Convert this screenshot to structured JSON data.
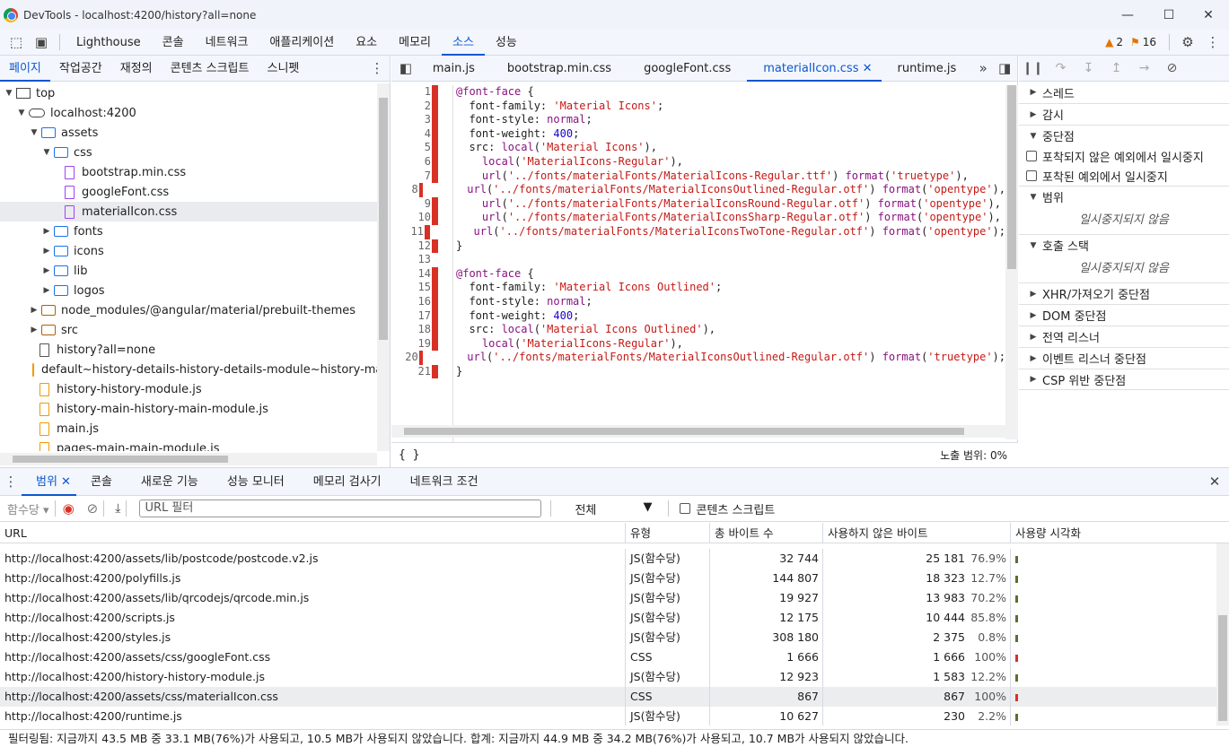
{
  "window": {
    "title": "DevTools - localhost:4200/history?all=none"
  },
  "main_tabs": [
    {
      "label": "Lighthouse"
    },
    {
      "label": "콘솔"
    },
    {
      "label": "네트워크"
    },
    {
      "label": "애플리케이션"
    },
    {
      "label": "요소"
    },
    {
      "label": "메모리"
    },
    {
      "label": "소스"
    },
    {
      "label": "성능"
    }
  ],
  "active_main_tab": "소스",
  "badges": {
    "warnings": "2",
    "issues": "16"
  },
  "left": {
    "tabs": [
      "페이지",
      "작업공간",
      "재정의",
      "콘텐츠 스크립트",
      "스니펫"
    ],
    "tree": [
      {
        "label": "top",
        "indent": 0,
        "kind": "frame",
        "open": true
      },
      {
        "label": "localhost:4200",
        "indent": 1,
        "kind": "cloud",
        "open": true
      },
      {
        "label": "assets",
        "indent": 2,
        "kind": "folder",
        "open": true
      },
      {
        "label": "css",
        "indent": 3,
        "kind": "folder",
        "open": true
      },
      {
        "label": "bootstrap.min.css",
        "indent": 4,
        "kind": "css"
      },
      {
        "label": "googleFont.css",
        "indent": 4,
        "kind": "css"
      },
      {
        "label": "materialIcon.css",
        "indent": 4,
        "kind": "css",
        "selected": true
      },
      {
        "label": "fonts",
        "indent": 3,
        "kind": "folder",
        "open": false
      },
      {
        "label": "icons",
        "indent": 3,
        "kind": "folder",
        "open": false
      },
      {
        "label": "lib",
        "indent": 3,
        "kind": "folder",
        "open": false
      },
      {
        "label": "logos",
        "indent": 3,
        "kind": "folder",
        "open": false
      },
      {
        "label": "node_modules/@angular/material/prebuilt-themes",
        "indent": 2,
        "kind": "folder-brown",
        "open": false
      },
      {
        "label": "src",
        "indent": 2,
        "kind": "folder-brown",
        "open": false
      },
      {
        "label": "history?all=none",
        "indent": 2,
        "kind": "doc"
      },
      {
        "label": "default~history-details-history-details-module~history-main-history-main-module.js",
        "indent": 2,
        "kind": "js"
      },
      {
        "label": "history-history-module.js",
        "indent": 2,
        "kind": "js"
      },
      {
        "label": "history-main-history-main-module.js",
        "indent": 2,
        "kind": "js"
      },
      {
        "label": "main.js",
        "indent": 2,
        "kind": "js"
      },
      {
        "label": "pages-main-main-module.js",
        "indent": 2,
        "kind": "js"
      }
    ]
  },
  "editor": {
    "tabs": [
      "main.js",
      "bootstrap.min.css",
      "googleFont.css",
      "materialIcon.css",
      "runtime.js"
    ],
    "active_tab": "materialIcon.css",
    "status_coverage": "노출 범위: 0%",
    "lines": [
      {
        "n": "1",
        "text": "@font-face {",
        "cov": true
      },
      {
        "n": "2",
        "text": "  font-family: 'Material Icons';",
        "cov": true
      },
      {
        "n": "3",
        "text": "  font-style: normal;",
        "cov": true
      },
      {
        "n": "4",
        "text": "  font-weight: 400;",
        "cov": true
      },
      {
        "n": "5",
        "text": "  src: local('Material Icons'),",
        "cov": true
      },
      {
        "n": "6",
        "text": "    local('MaterialIcons-Regular'),",
        "cov": true
      },
      {
        "n": "7",
        "text": "    url('../fonts/materialFonts/MaterialIcons-Regular.ttf') format('truetype'),",
        "cov": true
      },
      {
        "n": "8",
        "text": "    url('../fonts/materialFonts/MaterialIconsOutlined-Regular.otf') format('opentype'),",
        "cov": true
      },
      {
        "n": "9",
        "text": "    url('../fonts/materialFonts/MaterialIconsRound-Regular.otf') format('opentype'),",
        "cov": true
      },
      {
        "n": "10",
        "text": "    url('../fonts/materialFonts/MaterialIconsSharp-Regular.otf') format('opentype'),",
        "cov": true
      },
      {
        "n": "11",
        "text": "    url('../fonts/materialFonts/MaterialIconsTwoTone-Regular.otf') format('opentype');",
        "cov": true
      },
      {
        "n": "12",
        "text": "}",
        "cov": true
      },
      {
        "n": "13",
        "text": "",
        "cov": false
      },
      {
        "n": "14",
        "text": "@font-face {",
        "cov": true
      },
      {
        "n": "15",
        "text": "  font-family: 'Material Icons Outlined';",
        "cov": true
      },
      {
        "n": "16",
        "text": "  font-style: normal;",
        "cov": true
      },
      {
        "n": "17",
        "text": "  font-weight: 400;",
        "cov": true
      },
      {
        "n": "18",
        "text": "  src: local('Material Icons Outlined'),",
        "cov": true
      },
      {
        "n": "19",
        "text": "    local('MaterialIcons-Regular'),",
        "cov": true
      },
      {
        "n": "20",
        "text": "    url('../fonts/materialFonts/MaterialIconsOutlined-Regular.otf') format('truetype');",
        "cov": true
      },
      {
        "n": "21",
        "text": "}",
        "cov": true
      }
    ]
  },
  "debugger": {
    "threads": "스레드",
    "watch": "감시",
    "breakpoints": "중단점",
    "pause_uncaught": "포착되지 않은 예외에서 일시중지",
    "pause_caught": "포착된 예외에서 일시중지",
    "scope": "범위",
    "not_paused_1": "일시중지되지 않음",
    "call_stack": "호출 스택",
    "not_paused_2": "일시중지되지 않음",
    "xhr": "XHR/가져오기 중단점",
    "dom": "DOM 중단점",
    "global": "전역 리스너",
    "event": "이벤트 리스너 중단점",
    "csp": "CSP 위반 중단점"
  },
  "drawer": {
    "tabs": [
      "범위",
      "콘솔",
      "새로운 기능",
      "성능 모니터",
      "메모리 검사기",
      "네트워크 조건"
    ],
    "granularity": "함수당",
    "url_filter_placeholder": "URL 필터",
    "type_filter": "전체",
    "content_scripts": "콘텐츠 스크립트",
    "columns": [
      "URL",
      "유형",
      "총 바이트 수",
      "사용하지 않은 바이트",
      "사용량 시각화"
    ],
    "rows": [
      {
        "url": "http://localhost:4200/assets/lib/postcode/postcode.v2.js",
        "type": "JS(함수당)",
        "total": "32 744",
        "unused": "25 181",
        "pct": "76.9%",
        "bar": "#5b6f2f"
      },
      {
        "url": "http://localhost:4200/polyfills.js",
        "type": "JS(함수당)",
        "total": "144 807",
        "unused": "18 323",
        "pct": "12.7%",
        "bar": "#5b6f2f"
      },
      {
        "url": "http://localhost:4200/assets/lib/qrcodejs/qrcode.min.js",
        "type": "JS(함수당)",
        "total": "19 927",
        "unused": "13 983",
        "pct": "70.2%",
        "bar": "#5b6f2f"
      },
      {
        "url": "http://localhost:4200/scripts.js",
        "type": "JS(함수당)",
        "total": "12 175",
        "unused": "10 444",
        "pct": "85.8%",
        "bar": "#5b6f2f"
      },
      {
        "url": "http://localhost:4200/styles.js",
        "type": "JS(함수당)",
        "total": "308 180",
        "unused": "2 375",
        "pct": "0.8%",
        "bar": "#5b6f2f"
      },
      {
        "url": "http://localhost:4200/assets/css/googleFont.css",
        "type": "CSS",
        "total": "1 666",
        "unused": "1 666",
        "pct": "100%",
        "bar": "#d93025"
      },
      {
        "url": "http://localhost:4200/history-history-module.js",
        "type": "JS(함수당)",
        "total": "12 923",
        "unused": "1 583",
        "pct": "12.2%",
        "bar": "#5b6f2f"
      },
      {
        "url": "http://localhost:4200/assets/css/materialIcon.css",
        "type": "CSS",
        "total": "867",
        "unused": "867",
        "pct": "100%",
        "bar": "#d93025",
        "selected": true
      },
      {
        "url": "http://localhost:4200/runtime.js",
        "type": "JS(함수당)",
        "total": "10 627",
        "unused": "230",
        "pct": "2.2%",
        "bar": "#5b6f2f"
      }
    ],
    "summary": "필터링됨: 지금까지 43.5 MB 중 33.1 MB(76%)가 사용되고, 10.5 MB가 사용되지 않았습니다. 합계: 지금까지 44.9 MB 중 34.2 MB(76%)가 사용되고, 10.7 MB가 사용되지 않았습니다."
  }
}
